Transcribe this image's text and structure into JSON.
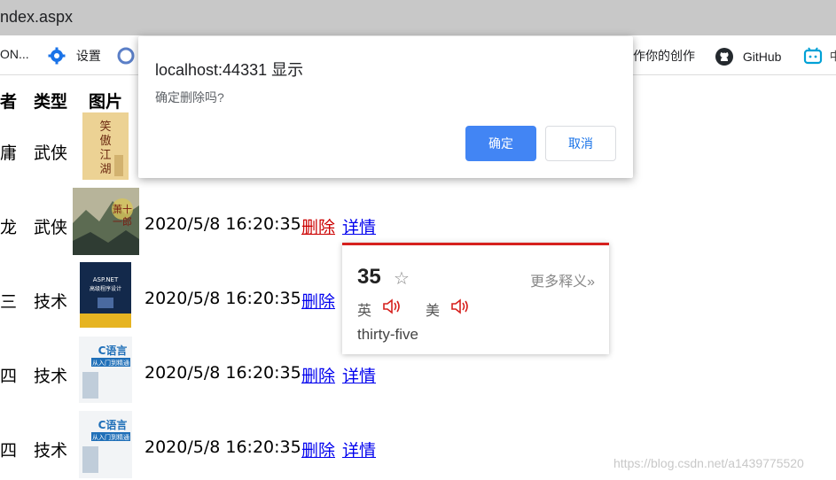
{
  "browser": {
    "url_fragment": "ndex.aspx",
    "bookmarks": [
      {
        "label": "ON...",
        "icon": "truncated-bookmark"
      },
      {
        "label": "设置",
        "icon": "gear-icon"
      },
      {
        "label": "作你的创作",
        "icon": "truncated-bookmark"
      },
      {
        "label": "GitHub",
        "icon": "github-icon"
      },
      {
        "label": "",
        "icon": "bilibili-icon"
      }
    ]
  },
  "table": {
    "headers": [
      "者",
      "类型",
      "图片"
    ],
    "rows": [
      {
        "author": "庸",
        "type": "武侠",
        "cover": "xiaoao-jianghu-cover",
        "time": "",
        "delete": "",
        "detail": ""
      },
      {
        "author": "龙",
        "type": "武侠",
        "cover": "xiao-shiyilang-cover",
        "time": "2020/5/8 16:20:35",
        "delete": "删除",
        "detail": "详情"
      },
      {
        "author": "三",
        "type": "技术",
        "cover": "aspnet-book-cover",
        "time": "2020/5/8 16:20:35",
        "delete": "删除",
        "detail": ""
      },
      {
        "author": "四",
        "type": "技术",
        "cover": "c-language-book-cover",
        "time": "2020/5/8 16:20:35",
        "delete": "删除",
        "detail": "详情"
      },
      {
        "author": "四",
        "type": "技术",
        "cover": "c-language-book-cover",
        "time": "2020/5/8 16:20:35",
        "delete": "删除",
        "detail": "详情"
      }
    ]
  },
  "dialog": {
    "title": "localhost:44331 显示",
    "message": "确定删除吗?",
    "ok_label": "确定",
    "cancel_label": "取消",
    "accent": "#4285f4"
  },
  "translation_popup": {
    "word": "35",
    "more_label": "更多释义»",
    "uk_label": "英",
    "us_label": "美",
    "meaning": "thirty-five",
    "accent": "#d6201d"
  },
  "watermark": "https://blog.csdn.net/a1439775520"
}
